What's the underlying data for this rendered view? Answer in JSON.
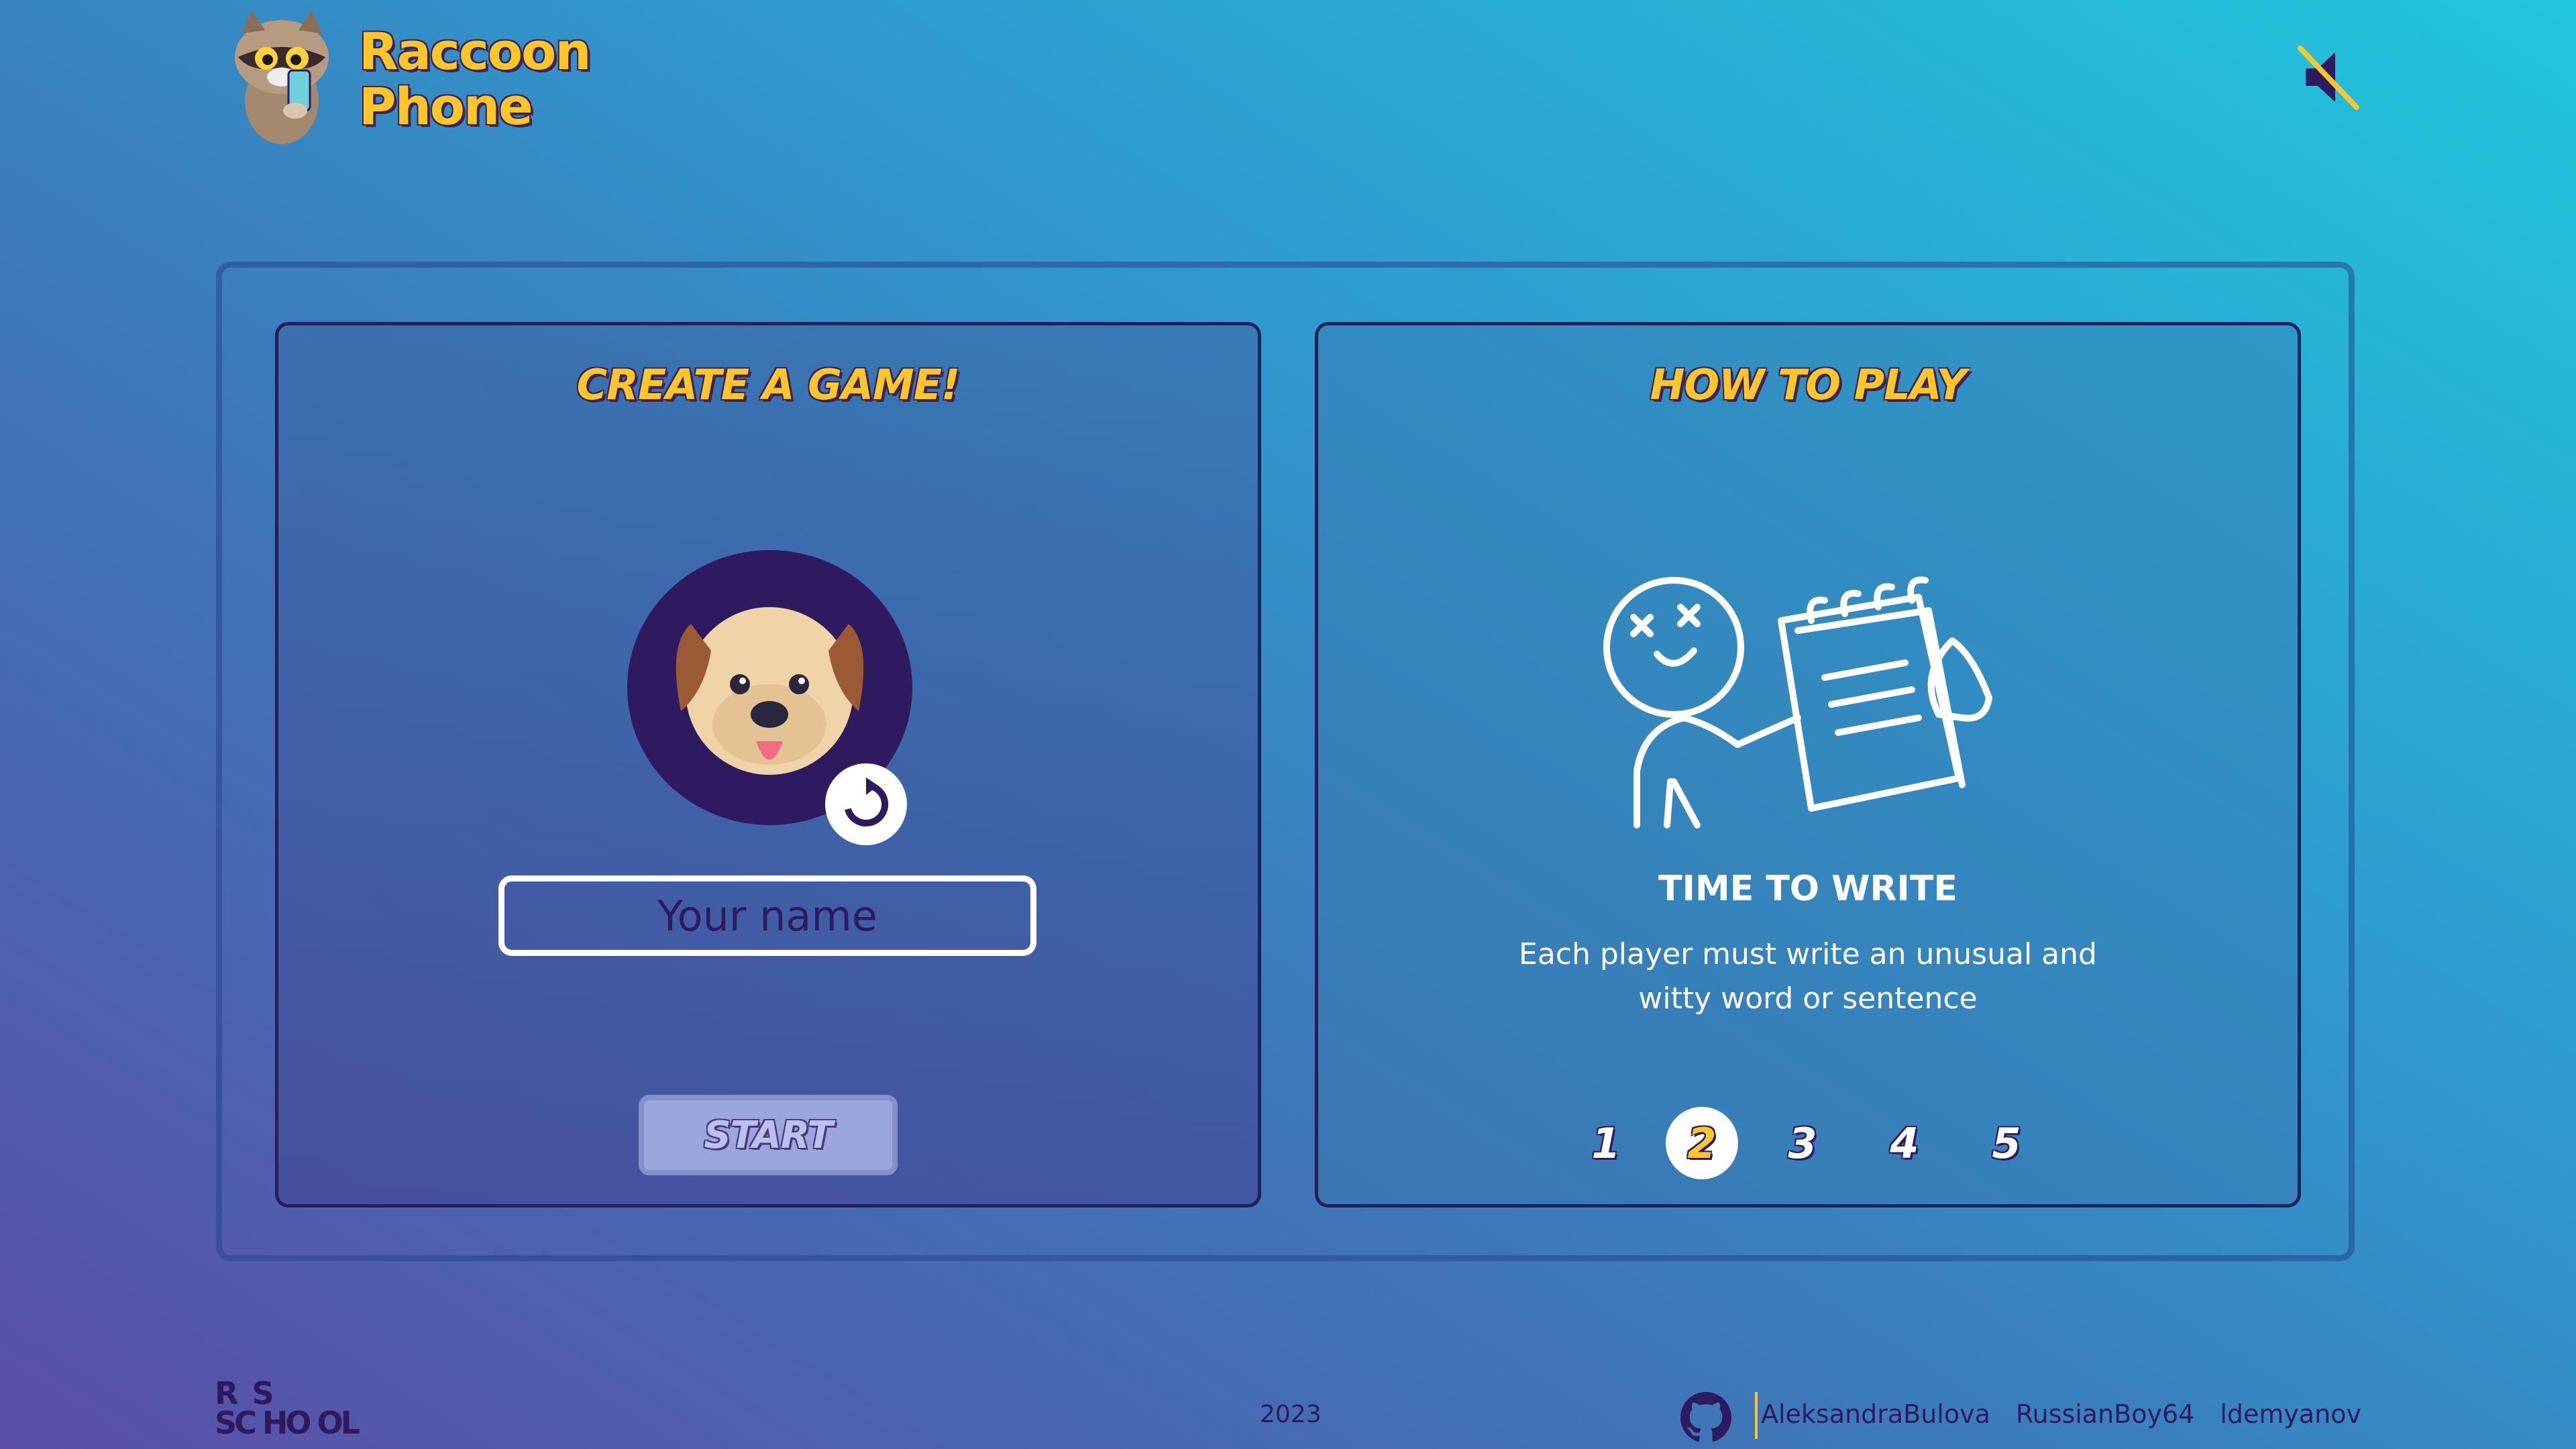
{
  "header": {
    "app_name_line1": "Raccoon",
    "app_name_line2": "Phone",
    "mute_icon": "speaker-muted-icon"
  },
  "create_game": {
    "title": "CREATE A GAME!",
    "avatar_icon": "dog-avatar-icon",
    "refresh_icon": "refresh-icon",
    "name_placeholder": "Your name",
    "name_value": "",
    "start_label": "START"
  },
  "how_to_play": {
    "title": "HOW TO PLAY",
    "illustration_icon": "person-writing-notepad-icon",
    "step_title": "TIME TO WRITE",
    "step_description": "Each player must write an unusual and witty word or sentence",
    "steps": [
      "1",
      "2",
      "3",
      "4",
      "5"
    ],
    "active_step": "2"
  },
  "footer": {
    "school_logo_lines": [
      "R  S",
      "SC HO OL"
    ],
    "year": "2023",
    "github_icon": "github-icon",
    "authors": [
      "AleksandraBulova",
      "RussianBoy64",
      "ldemyanov"
    ]
  },
  "colors": {
    "accent_yellow": "#ffc62a",
    "dark_purple": "#2e1a5e",
    "panel_border": "#23205a",
    "start_button": "#9aa6dc"
  }
}
